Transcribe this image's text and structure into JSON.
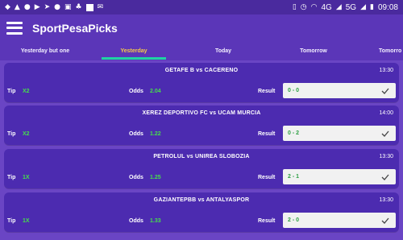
{
  "status_bar": {
    "network_label": "4G",
    "network_label_2": "5G",
    "time": "09:08"
  },
  "header": {
    "title": "SportPesaPicks"
  },
  "tabs": [
    {
      "label": "Yesterday but one",
      "active": false
    },
    {
      "label": "Yesterday",
      "active": true
    },
    {
      "label": "Today",
      "active": false
    },
    {
      "label": "Tomorrow",
      "active": false
    },
    {
      "label": "Tomorro",
      "active": false
    }
  ],
  "labels": {
    "tip": "Tip",
    "odds": "Odds",
    "result": "Result"
  },
  "matches": [
    {
      "teams": "GETAFE B vs CACERENO",
      "time": "13:30",
      "tip": "X2",
      "odds": "2.04",
      "result": "0 - 0"
    },
    {
      "teams": "XEREZ DEPORTIVO FC vs UCAM MURCIA",
      "time": "14:00",
      "tip": "X2",
      "odds": "1.22",
      "result": "0 - 2"
    },
    {
      "teams": "PETROLUL vs UNIREA SLOBOZIA",
      "time": "13:30",
      "tip": "1X",
      "odds": "1.25",
      "result": "2 - 1"
    },
    {
      "teams": "GAZIANTEPBB vs ANTALYASPOR",
      "time": "13:30",
      "tip": "1X",
      "odds": "1.33",
      "result": "2 - 0"
    }
  ],
  "colors": {
    "accent": "#f7c948",
    "tip_value": "#46e04b",
    "result_text": "#2ea043",
    "underline": "#1fd3a3"
  }
}
